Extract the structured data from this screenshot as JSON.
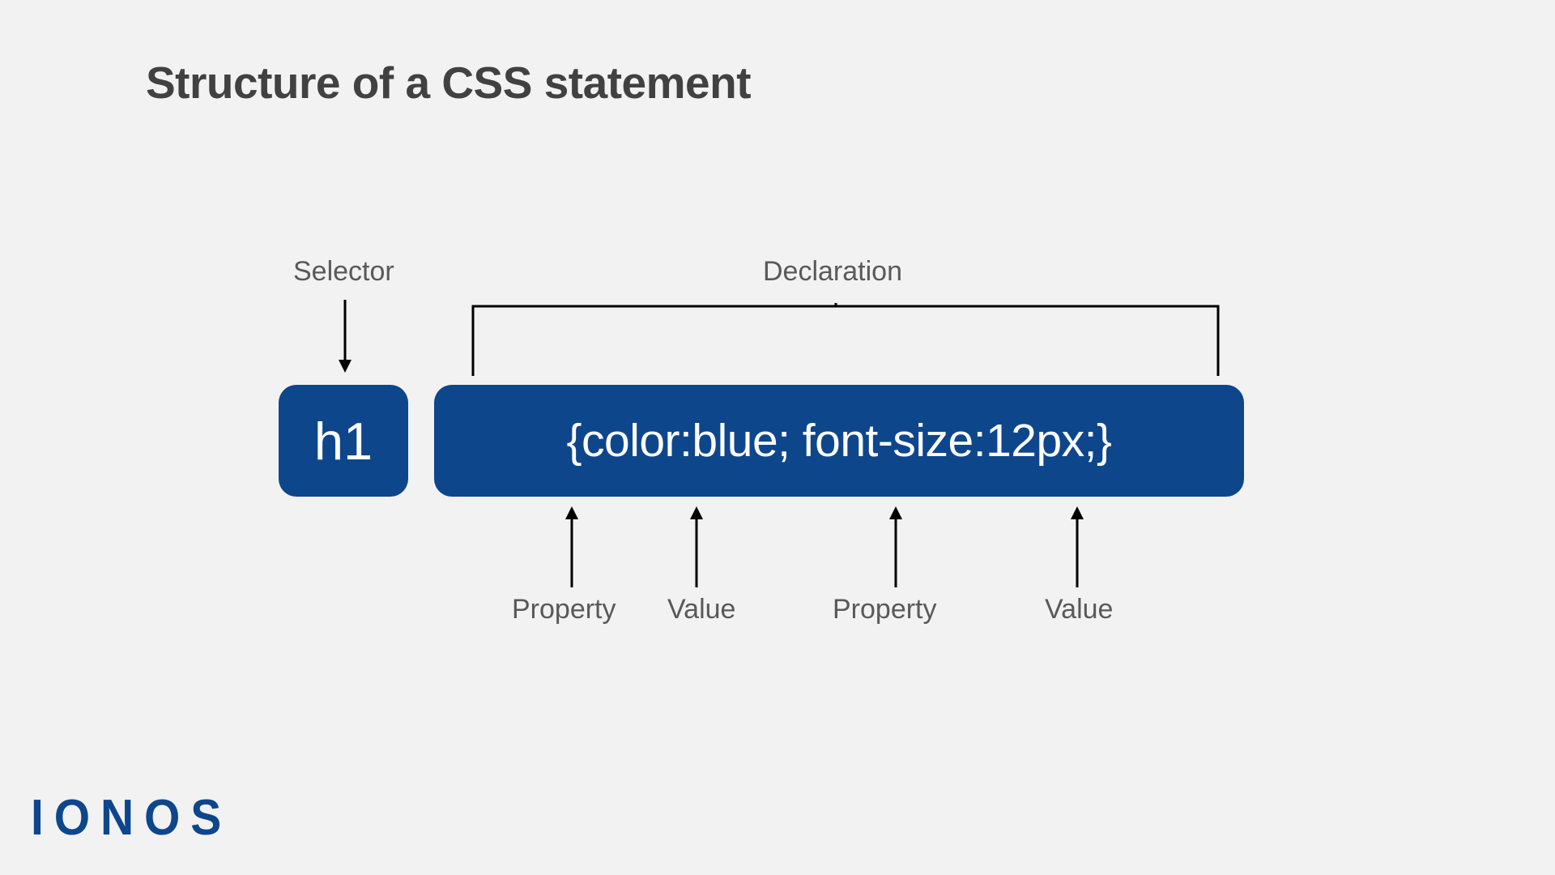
{
  "title": "Structure of a CSS statement",
  "labels": {
    "selector": "Selector",
    "declaration": "Declaration",
    "property1": "Property",
    "value1": "Value",
    "property2": "Property",
    "value2": "Value"
  },
  "box": {
    "selector": "h1",
    "declaration": "{color:blue; font-size:12px;}"
  },
  "brand": "IONOS",
  "colors": {
    "boxFill": "#0e468c",
    "text": "#414141",
    "labelText": "#595959",
    "arrow": "#000000"
  }
}
